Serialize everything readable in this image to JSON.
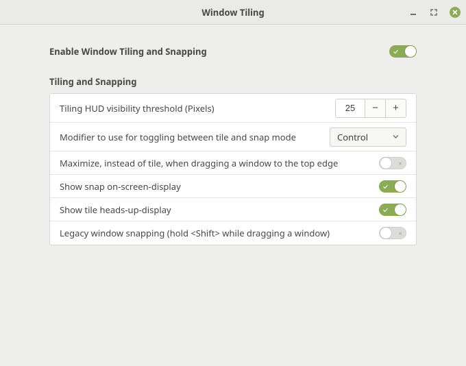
{
  "window": {
    "title": "Window Tiling"
  },
  "main": {
    "enable_label": "Enable Window Tiling and Snapping",
    "enable_on": true
  },
  "section_heading": "Tiling and Snapping",
  "rows": {
    "hud_threshold": {
      "label": "Tiling HUD visibility threshold (Pixels)",
      "value": "25"
    },
    "modifier": {
      "label": "Modifier to use for toggling between tile and snap mode",
      "value": "Control"
    },
    "maximize_top": {
      "label": "Maximize, instead of tile, when dragging a window to the top edge",
      "on": false
    },
    "snap_osd": {
      "label": "Show snap on-screen-display",
      "on": true
    },
    "tile_hud": {
      "label": "Show tile heads-up-display",
      "on": true
    },
    "legacy": {
      "label": "Legacy window snapping (hold <Shift> while dragging a window)",
      "on": false
    }
  }
}
